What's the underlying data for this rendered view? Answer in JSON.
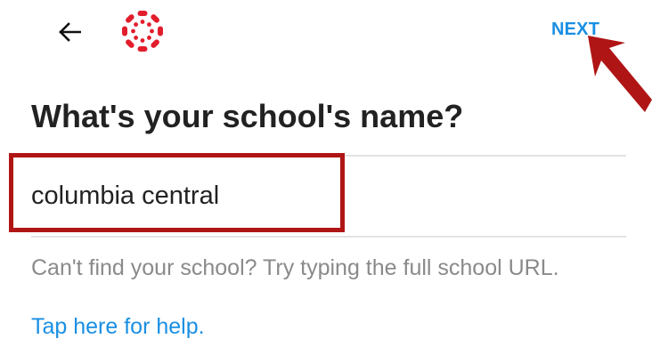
{
  "header": {
    "back_icon": "arrow-left-icon",
    "logo_icon": "canvas-logo-icon",
    "next_label": "NEXT",
    "accent_color": "#1a8fe3",
    "logo_color": "#e21d2c"
  },
  "main": {
    "title": "What's your school's name?",
    "school_input": {
      "value": "columbia central"
    },
    "hint": "Can't find your school? Try typing the full school URL.",
    "help_link": "Tap here for help."
  },
  "annotations": {
    "highlight_color": "#b01515"
  }
}
